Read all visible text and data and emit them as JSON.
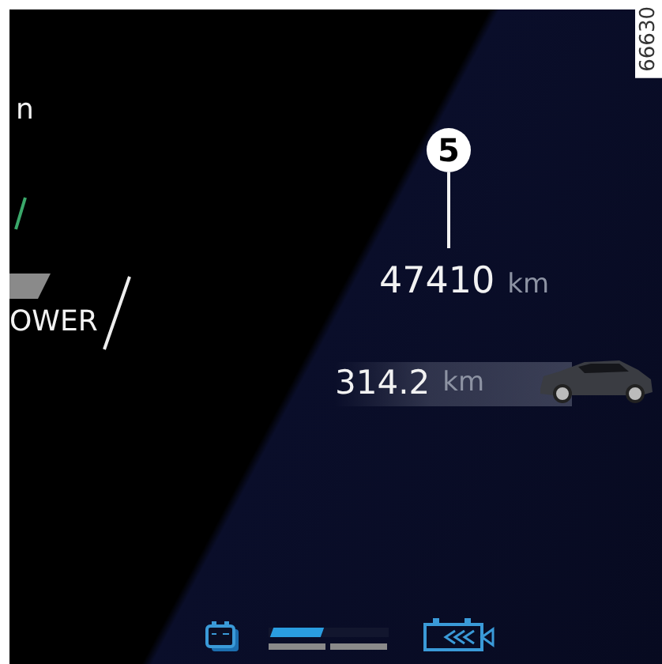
{
  "figure_number": "66630",
  "left_panel": {
    "mode_label": "n",
    "power_label": "OWER"
  },
  "callout": {
    "number": "5"
  },
  "odometer": {
    "value": "47410",
    "unit": "km"
  },
  "range": {
    "value": "314.2",
    "unit": "km"
  },
  "battery_gauge": {
    "level": 0.5
  }
}
